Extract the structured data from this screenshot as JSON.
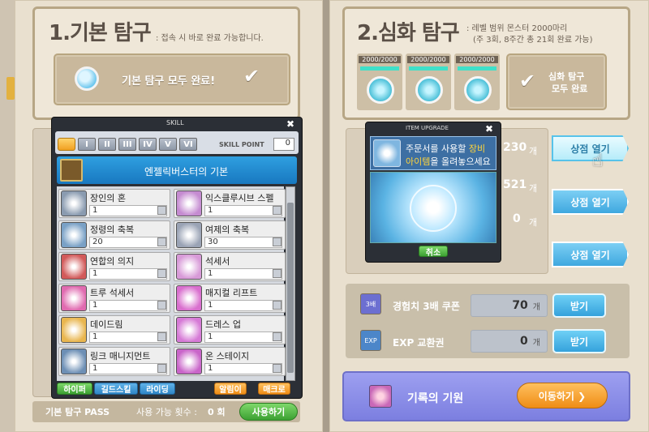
{
  "left": {
    "title": "1.기본 탐구",
    "subtitle": ": 접속 시 바로 완료 가능합니다.",
    "banner_label": "기본 탐구 모두 완료!",
    "pass_label": "기본 탐구 PASS",
    "usable_label": "사용 가능 횟수 :",
    "usable_count": "0 회",
    "use_button": "사용하기"
  },
  "right": {
    "title": "2.심화 탐구",
    "subtitle_line1": ": 레벨 범위 몬스터 2000마리",
    "subtitle_line2": "(주 3회, 8주간 총 21회 완료 가능)",
    "progress": [
      {
        "label": "2000/2000",
        "fraction": 1.0
      },
      {
        "label": "2000/2000",
        "fraction": 1.0
      },
      {
        "label": "2000/2000",
        "fraction": 1.0
      }
    ],
    "complete_line1": "심화 탐구",
    "complete_line2": "모두 완료",
    "shop_rows": [
      {
        "count": "230",
        "unit": "개",
        "button": "상점 열기",
        "style": "light"
      },
      {
        "count": "521",
        "unit": "개",
        "button": "상점 열기",
        "style": "blue"
      },
      {
        "count": "0",
        "unit": "개",
        "button": "상점 열기",
        "style": "blue"
      }
    ],
    "items": [
      {
        "name": "경험치 3배 쿠폰",
        "count": "70",
        "unit": "개",
        "button": "받기",
        "icon_text": "3배"
      },
      {
        "name": "EXP 교환권",
        "count": "0",
        "unit": "개",
        "button": "받기",
        "icon_text": "EXP"
      }
    ],
    "record": {
      "name": "기록의 기원",
      "button": "이동하기 ❯"
    }
  },
  "skill_window": {
    "title": "SKILL",
    "tabs": [
      "I",
      "II",
      "III",
      "IV",
      "V",
      "VI"
    ],
    "skill_point_label": "SKILL POINT",
    "skill_point": "0",
    "job_name": "엔젤릭버스터의 기본",
    "skills": [
      {
        "name": "장인의 혼",
        "level": "1",
        "color": "#8a9bb0"
      },
      {
        "name": "익스클루시브 스펠",
        "level": "1",
        "color": "#c58bd1"
      },
      {
        "name": "정령의 축복",
        "level": "20",
        "color": "#7aa1c6"
      },
      {
        "name": "여제의 축복",
        "level": "30",
        "color": "#9aa3b5"
      },
      {
        "name": "연합의 의지",
        "level": "1",
        "color": "#d25a5a"
      },
      {
        "name": "석세서",
        "level": "1",
        "color": "#d89ad8"
      },
      {
        "name": "트루 석세서",
        "level": "1",
        "color": "#e06bb0"
      },
      {
        "name": "매지컬 리프트",
        "level": "1",
        "color": "#d96fce"
      },
      {
        "name": "데이드림",
        "level": "1",
        "color": "#e9b64f"
      },
      {
        "name": "드레스 업",
        "level": "1",
        "color": "#d67ad6"
      },
      {
        "name": "링크 매니지먼트",
        "level": "1",
        "color": "#6d8fb5"
      },
      {
        "name": "온 스테이지",
        "level": "1",
        "color": "#c965c9"
      }
    ],
    "footer_left": [
      "하이퍼",
      "길드스킬",
      "라이딩"
    ],
    "footer_right": [
      "알림이",
      "매크로"
    ]
  },
  "upgrade_window": {
    "title": "ITEM UPGRADE",
    "instruction_line1_a": "주문서를 사용할",
    "instruction_line1_b": "장비",
    "instruction_line2_a": "아이템",
    "instruction_line2_b": "을 올려놓으세요",
    "cancel": "취소"
  },
  "colors": {
    "accent_blue": "#3fa8df",
    "panel": "#e9e0cf",
    "window_dark": "#2b2f36"
  }
}
